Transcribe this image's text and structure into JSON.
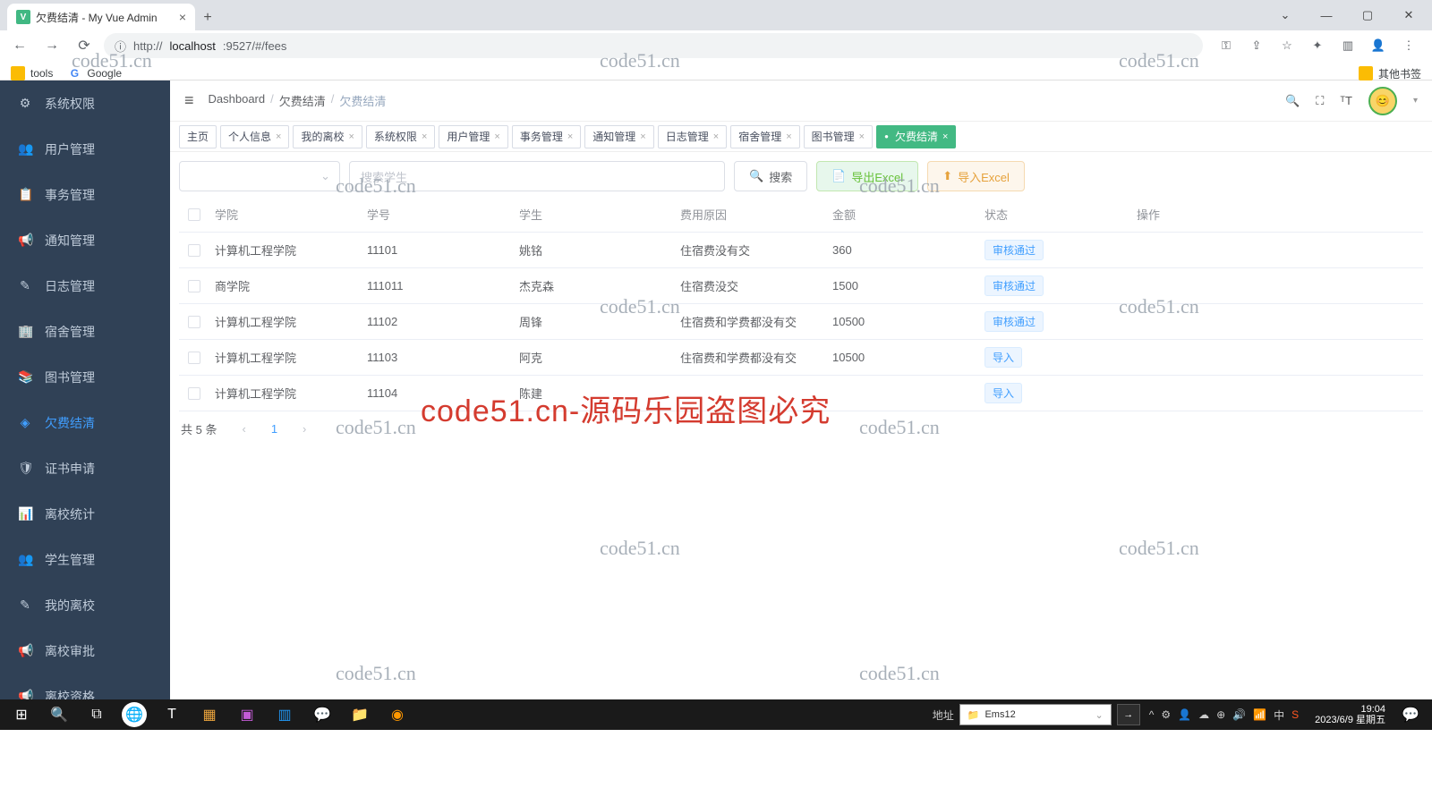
{
  "browser": {
    "tab_title": "欠费结清 - My Vue Admin",
    "url_prefix": "http://",
    "url_host": "localhost",
    "url_path": ":9527/#/fees",
    "bookmark_tools": "tools",
    "bookmark_google": "Google",
    "bookmark_other": "其他书签"
  },
  "sidebar": {
    "items": [
      {
        "label": "系统权限",
        "icon": "⚙"
      },
      {
        "label": "用户管理",
        "icon": "👥"
      },
      {
        "label": "事务管理",
        "icon": "📋"
      },
      {
        "label": "通知管理",
        "icon": "📢"
      },
      {
        "label": "日志管理",
        "icon": "✎"
      },
      {
        "label": "宿舍管理",
        "icon": "🏢"
      },
      {
        "label": "图书管理",
        "icon": "📚"
      },
      {
        "label": "欠费结清",
        "icon": "◈"
      },
      {
        "label": "证书申请",
        "icon": "🛡"
      },
      {
        "label": "离校统计",
        "icon": "📊"
      },
      {
        "label": "学生管理",
        "icon": "👥"
      },
      {
        "label": "我的离校",
        "icon": "✎"
      },
      {
        "label": "离校审批",
        "icon": "📢"
      },
      {
        "label": "离校资格",
        "icon": "📢"
      }
    ],
    "active_index": 7
  },
  "breadcrumb": {
    "root": "Dashboard",
    "mid": "欠费结清",
    "leaf": "欠费结清"
  },
  "tabs": [
    "主页",
    "个人信息",
    "我的离校",
    "系统权限",
    "用户管理",
    "事务管理",
    "通知管理",
    "日志管理",
    "宿舍管理",
    "图书管理",
    "欠费结清"
  ],
  "tabs_active_index": 10,
  "filters": {
    "search_placeholder": "搜索学生",
    "search_btn": "搜索",
    "export_btn": "导出Excel",
    "import_btn": "导入Excel"
  },
  "table": {
    "headers": [
      "学院",
      "学号",
      "学生",
      "费用原因",
      "金额",
      "状态",
      "操作"
    ],
    "rows": [
      {
        "college": "计算机工程学院",
        "sid": "11101",
        "student": "姚铭",
        "reason": "住宿费没有交",
        "amount": "360",
        "status": "审核通过"
      },
      {
        "college": "商学院",
        "sid": "111011",
        "student": "杰克森",
        "reason": "住宿费没交",
        "amount": "1500",
        "status": "审核通过"
      },
      {
        "college": "计算机工程学院",
        "sid": "11102",
        "student": "周锋",
        "reason": "住宿费和学费都没有交",
        "amount": "10500",
        "status": "审核通过"
      },
      {
        "college": "计算机工程学院",
        "sid": "11103",
        "student": "阿克",
        "reason": "住宿费和学费都没有交",
        "amount": "10500",
        "status": "导入"
      },
      {
        "college": "计算机工程学院",
        "sid": "11104",
        "student": "陈建",
        "reason": "",
        "amount": "",
        "status": "导入"
      }
    ]
  },
  "pager": {
    "total": "共 5 条",
    "current": "1"
  },
  "watermarks": {
    "small": "code51.cn",
    "big": "code51.cn-源码乐园盗图必究"
  },
  "taskbar": {
    "label": "地址",
    "search_value": "Ems12",
    "time": "19:04",
    "date": "2023/6/9 星期五"
  }
}
